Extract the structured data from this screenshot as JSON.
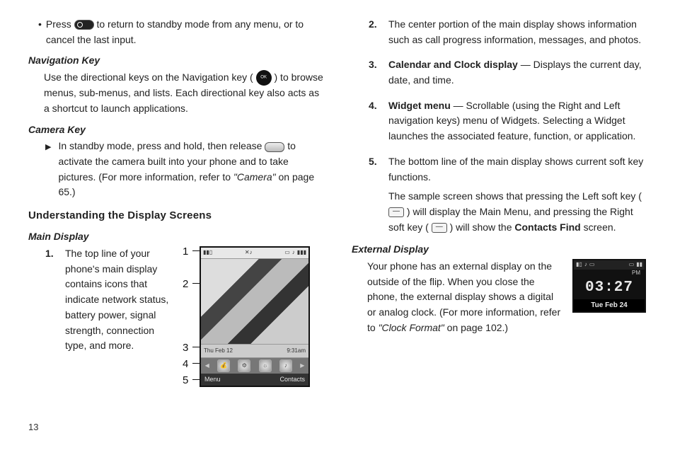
{
  "page_number": "13",
  "left": {
    "press_return_1": "Press ",
    "press_return_2": " to return to standby mode from any menu, or to cancel the last input.",
    "nav_head": "Navigation Key",
    "nav_body_1": "Use the directional keys on the Navigation key (",
    "nav_body_2": ") to browse menus, sub-menus, and lists. Each directional key also acts as a shortcut to launch applications.",
    "cam_head": "Camera Key",
    "cam_body_1": "In standby mode, press and hold, then release ",
    "cam_body_2": " to activate the camera built into your phone and to take pictures. (For more information, refer to ",
    "cam_ref": "\"Camera\"",
    "cam_body_3": " on page 65.)",
    "uds_head": "Understanding the Display Screens",
    "md_head": "Main Display",
    "md_item1_n": "1.",
    "md_item1_t": "The top line of your phone's main display contains icons that indicate network status, battery power, signal strength, connection type, and more.",
    "labels": {
      "l1": "1",
      "l2": "2",
      "l3": "3",
      "l4": "4",
      "l5": "5"
    },
    "md_clock_day": "Thu Feb 12",
    "md_clock_time": "9:31am",
    "md_soft_left": "Menu",
    "md_soft_right": "Contacts"
  },
  "right": {
    "item2_n": "2.",
    "item2_t": "The center portion of the main display shows information such as call progress information, messages, and photos.",
    "item3_n": "3.",
    "item3_lbl": "Calendar and Clock display",
    "item3_t": " — Displays the current day, date, and time.",
    "item4_n": "4.",
    "item4_lbl": "Widget menu",
    "item4_t": " — Scrollable (using the Right and Left navigation keys) menu of Widgets. Selecting a Widget launches the associated feature, function, or application.",
    "item5_n": "5.",
    "item5_t": "The bottom line of the main display shows current soft key functions.",
    "item5_b1": "The sample screen shows that pressing the Left soft key (",
    "item5_b2": ") will display the Main Menu, and pressing the Right soft key (",
    "item5_b3": ") will show the ",
    "item5_b_lbl": "Contacts Find",
    "item5_b4": " screen.",
    "ext_head": "External Display",
    "ext_body_1": "Your phone has an external display on the outside of the flip. When you close the phone, the external display shows a digital or analog clock. (For more information, refer to ",
    "ext_ref": "\"Clock Format\"",
    "ext_body_2": " on page 102.)",
    "ext_pm": "PM",
    "ext_time": "03:27",
    "ext_date": "Tue Feb 24"
  }
}
